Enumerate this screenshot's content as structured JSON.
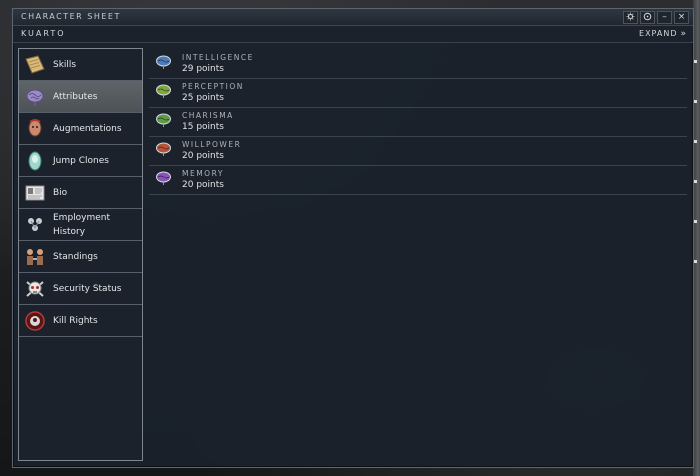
{
  "window": {
    "title": "CHARACTER SHEET",
    "buttons": {
      "options_icon": "gear-icon",
      "help_icon": "info-icon",
      "minimize": "–",
      "close": "×"
    }
  },
  "character": {
    "name": "KUARTO",
    "expand_label": "EXPAND",
    "expand_glyph": "»"
  },
  "sidebar": {
    "items": [
      {
        "label": "Skills",
        "icon": "skills-book-icon"
      },
      {
        "label": "Attributes",
        "icon": "attributes-brain-icon",
        "active": true
      },
      {
        "label": "Augmentations",
        "icon": "augmentations-head-icon"
      },
      {
        "label": "Jump Clones",
        "icon": "jump-clone-icon"
      },
      {
        "label": "Bio",
        "icon": "bio-document-icon"
      },
      {
        "label_line1": "Employment",
        "label_line2": "History",
        "icon": "employment-history-icon"
      },
      {
        "label": "Standings",
        "icon": "standings-icon"
      },
      {
        "label": "Security Status",
        "icon": "security-status-skull-icon"
      },
      {
        "label": "Kill Rights",
        "icon": "kill-rights-icon"
      }
    ]
  },
  "attributes": [
    {
      "name": "INTELLIGENCE",
      "value": "29 points",
      "color": "#4d7bb8"
    },
    {
      "name": "PERCEPTION",
      "value": "25 points",
      "color": "#7ea83f"
    },
    {
      "name": "CHARISMA",
      "value": "15 points",
      "color": "#5f9a45"
    },
    {
      "name": "WILLPOWER",
      "value": "20 points",
      "color": "#b5553a"
    },
    {
      "name": "MEMORY",
      "value": "20 points",
      "color": "#8a55b8"
    }
  ],
  "colors": {
    "window_bg": "#1a212b",
    "active_item": "#55595d",
    "text": "#e0e3e6"
  }
}
